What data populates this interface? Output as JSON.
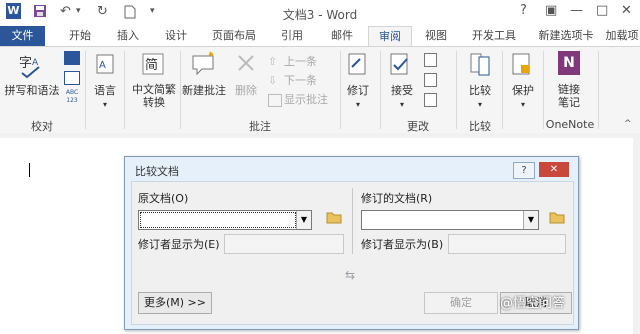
{
  "window": {
    "title": "文档3 - Word",
    "help_icon": "?",
    "minimize_icon": "—",
    "restore_icon": "□",
    "close_icon": "✕",
    "ribbon_options_icon": "▣"
  },
  "qat": {
    "word_logo": "W",
    "save_icon": "💾",
    "undo_icon": "↶",
    "redo_icon": "↻",
    "new_icon": "🗋",
    "more_icon": "▾"
  },
  "tabs": [
    "文件",
    "开始",
    "插入",
    "设计",
    "页面布局",
    "引用",
    "邮件",
    "审阅",
    "视图",
    "开发工具",
    "新建选项卡",
    "加载项"
  ],
  "ribbon": {
    "proofing": {
      "spelling_label": "拼写和语法",
      "group_label": "校对",
      "research_icon": "📖",
      "thesaurus_icon": "📓",
      "wordcount_icon": "ABC 123"
    },
    "language": {
      "label": "语言"
    },
    "chinese": {
      "label": "中文简繁\n转换",
      "label1": "中文简繁",
      "label2": "转换"
    },
    "comments": {
      "new_label": "新建批注",
      "delete_label": "删除",
      "prev_label": "上一条",
      "next_label": "下一条",
      "show_label": "显示批注",
      "group_label": "批注"
    },
    "tracking": {
      "track_label": "修订"
    },
    "changes": {
      "accept_label": "接受",
      "group_label": "更改"
    },
    "compare": {
      "compare_label": "比较",
      "group_label": "比较"
    },
    "protect": {
      "protect_label": "保护"
    },
    "onenote": {
      "link_label1": "链接",
      "link_label2": "笔记",
      "group_label": "OneNote"
    }
  },
  "dialog": {
    "title": "比较文档",
    "help": "?",
    "close": "✕",
    "original_label": "原文档(O)",
    "original_value": "",
    "revised_label": "修订的文档(R)",
    "revised_value": "",
    "label_changes_left": "修订者显示为(E)",
    "label_changes_right": "修订者显示为(B)",
    "swap_icon": "⇆",
    "more_button": "更多(M) >>",
    "ok_button": "确定",
    "cancel_button": "取消"
  },
  "watermark": "@悟空问答"
}
